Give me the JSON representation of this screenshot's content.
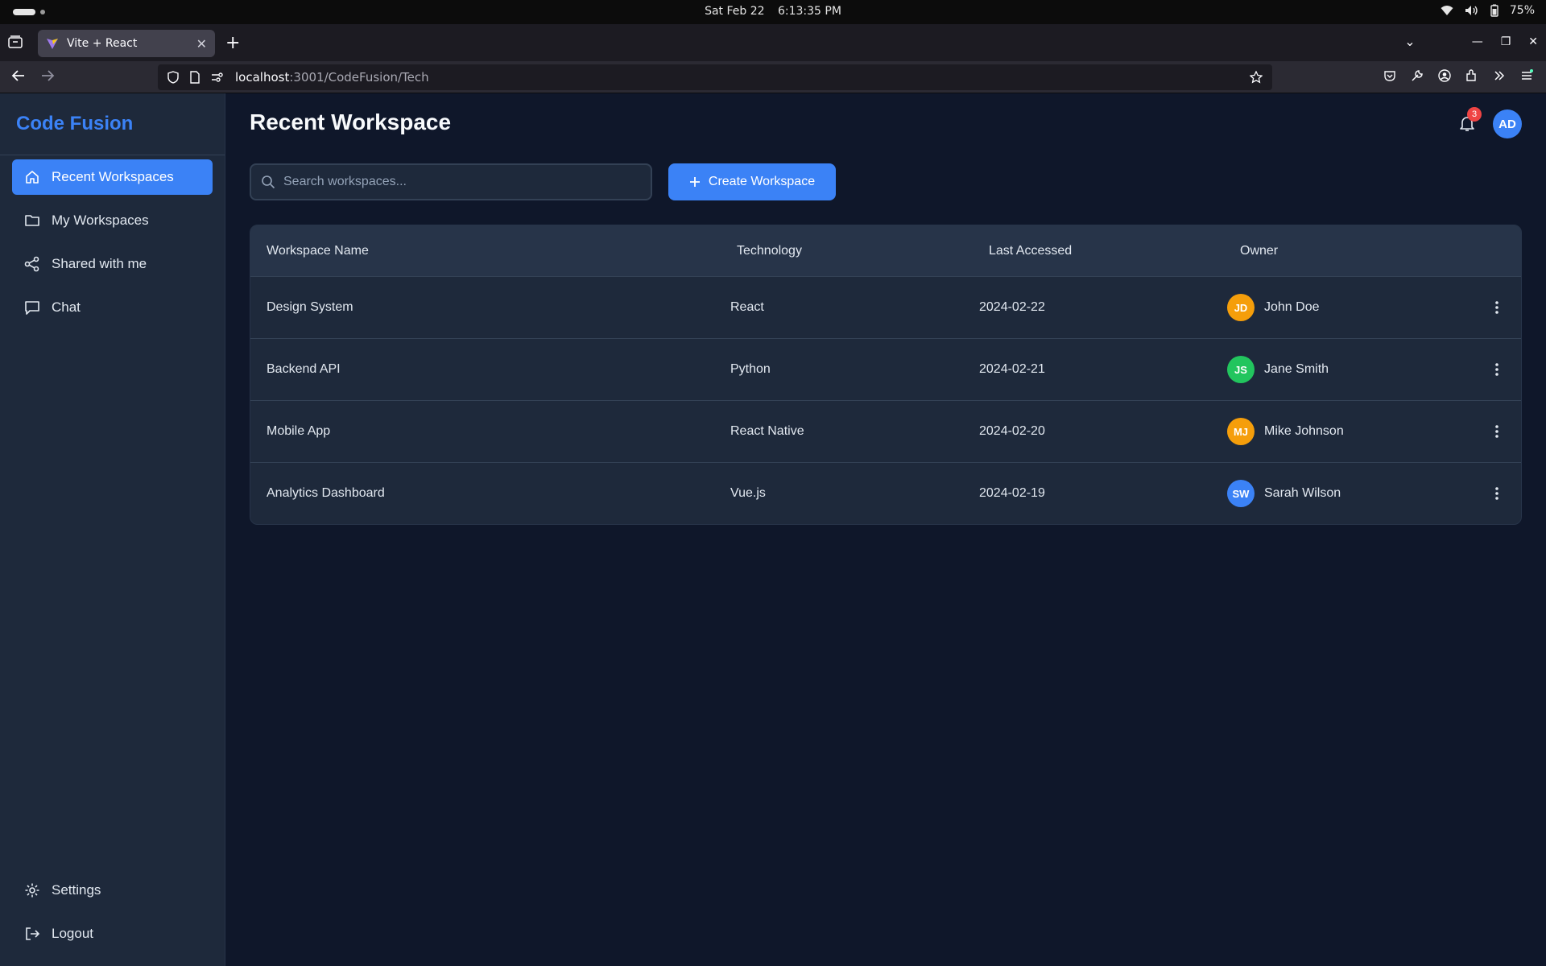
{
  "os": {
    "date": "Sat Feb 22",
    "time": "6:13:35 PM",
    "battery": "75%"
  },
  "browser": {
    "tab_title": "Vite + React",
    "url_host": "localhost",
    "url_path": ":3001/CodeFusion/Tech"
  },
  "app": {
    "brand": "Code Fusion",
    "nav": [
      {
        "label": "Recent Workspaces",
        "icon": "home-icon",
        "active": true
      },
      {
        "label": "My Workspaces",
        "icon": "folder-icon",
        "active": false
      },
      {
        "label": "Shared with me",
        "icon": "share-icon",
        "active": false
      },
      {
        "label": "Chat",
        "icon": "chat-icon",
        "active": false
      }
    ],
    "bottom_nav": [
      {
        "label": "Settings",
        "icon": "gear-icon"
      },
      {
        "label": "Logout",
        "icon": "logout-icon"
      }
    ],
    "page_title": "Recent Workspace",
    "notifications_count": "3",
    "user_initials": "AD",
    "search_placeholder": "Search workspaces...",
    "create_button": "Create Workspace",
    "colors": {
      "accent": "#3b82f6",
      "bg": "#0f172a",
      "sidebar": "#1e293b",
      "badge": "#ef4444"
    }
  },
  "table": {
    "headers": [
      "Workspace Name",
      "Technology",
      "Last Accessed",
      "Owner"
    ],
    "rows": [
      {
        "name": "Design System",
        "tech": "React",
        "date": "2024-02-22",
        "owner": "John Doe",
        "initials": "JD",
        "color": "#f59e0b"
      },
      {
        "name": "Backend API",
        "tech": "Python",
        "date": "2024-02-21",
        "owner": "Jane Smith",
        "initials": "JS",
        "color": "#22c55e"
      },
      {
        "name": "Mobile App",
        "tech": "React Native",
        "date": "2024-02-20",
        "owner": "Mike Johnson",
        "initials": "MJ",
        "color": "#f59e0b"
      },
      {
        "name": "Analytics Dashboard",
        "tech": "Vue.js",
        "date": "2024-02-19",
        "owner": "Sarah Wilson",
        "initials": "SW",
        "color": "#3b82f6"
      }
    ]
  }
}
